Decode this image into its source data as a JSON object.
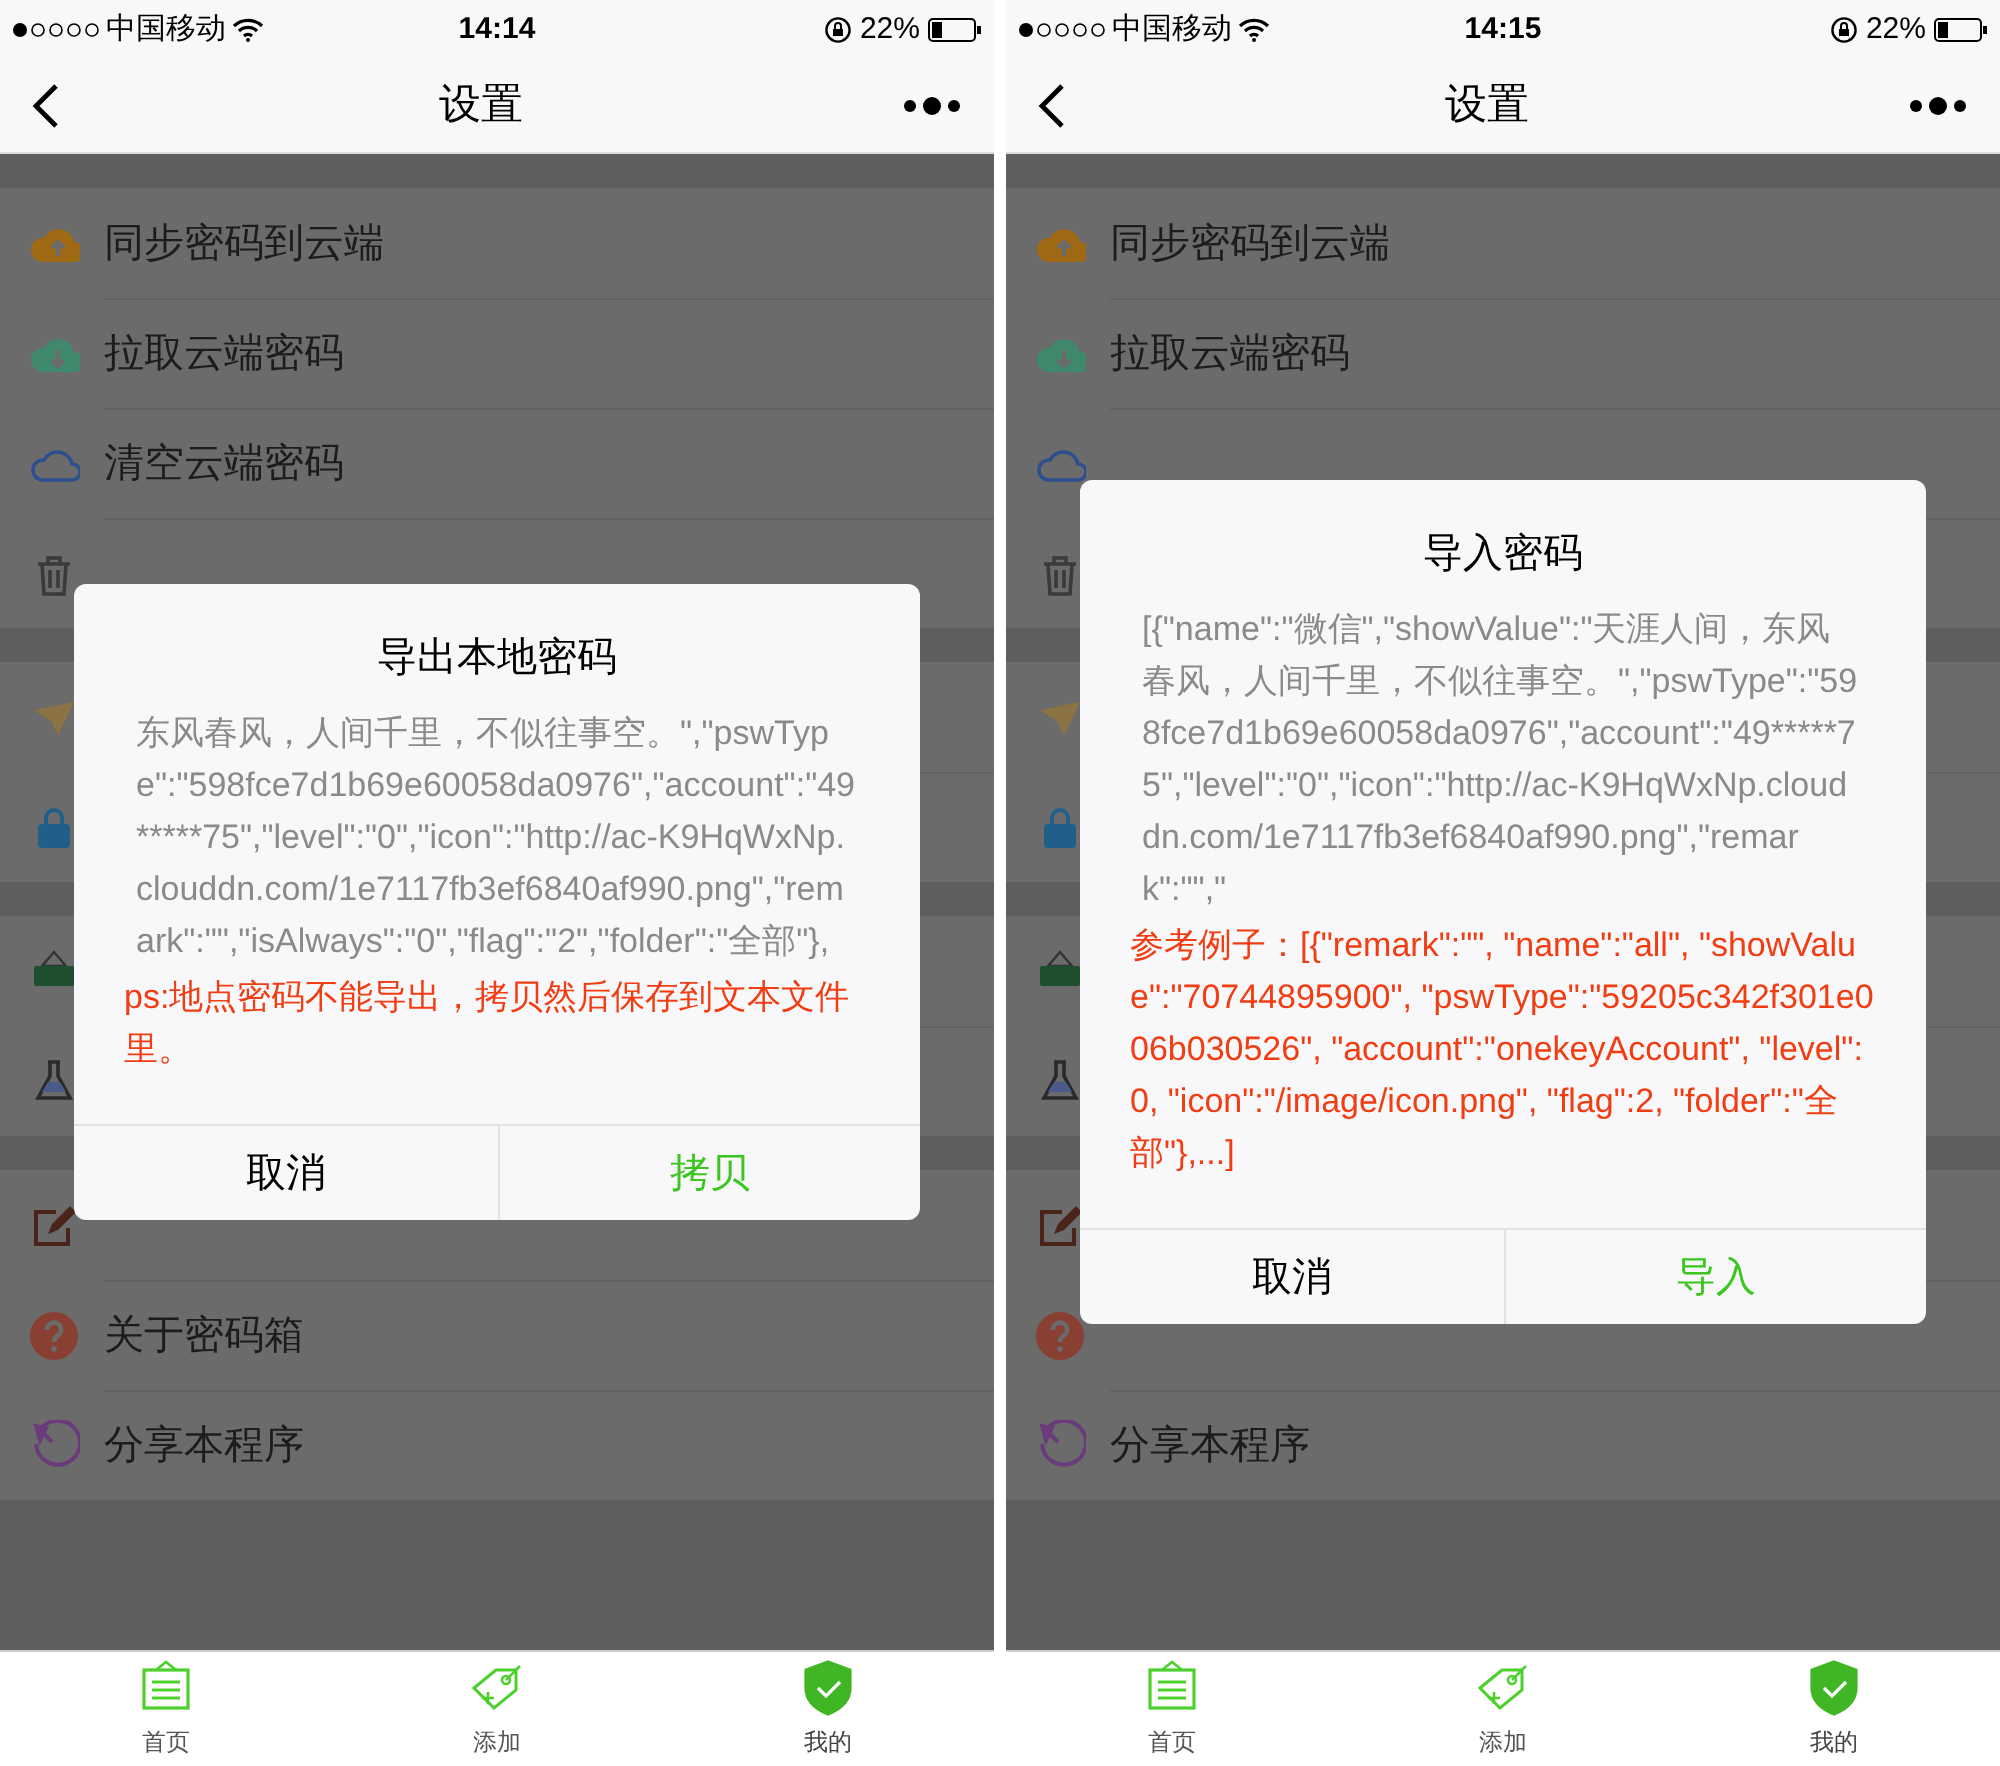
{
  "screens": [
    {
      "status_bar": {
        "carrier": "中国移动",
        "time": "14:14",
        "battery": "22%"
      },
      "nav": {
        "title": "设置"
      },
      "menu_groups": [
        {
          "items": [
            {
              "kind": "row",
              "label": "同步密码到云端"
            },
            {
              "kind": "row",
              "label": "拉取云端密码"
            },
            {
              "kind": "row",
              "label": "清空云端密码"
            },
            {
              "kind": "covered"
            }
          ]
        },
        {
          "items": [
            {
              "kind": "covered"
            },
            {
              "kind": "covered"
            }
          ]
        },
        {
          "items": [
            {
              "kind": "covered"
            },
            {
              "kind": "covered"
            }
          ]
        },
        {
          "items": [
            {
              "kind": "covered"
            },
            {
              "kind": "row",
              "label": "关于密码箱"
            },
            {
              "kind": "row",
              "label": "分享本程序"
            }
          ]
        }
      ],
      "dialog": {
        "title": "导出本地密码",
        "body": "东风春风，人间千里，不似往事空。\",\"pswType\":\"598fce7d1b69e60058da0976\",\"account\":\"49*****75\",\"level\":\"0\",\"icon\":\"http://ac-K9HqWxNp.clouddn.com/1e7117fb3ef6840af990.png\",\"remark\":\"\",\"isAlways\":\"0\",\"flag\":\"2\",\"folder\":\"全部\"},",
        "note": "ps:地点密码不能导出，拷贝然后保存到文本文件里。",
        "buttons": [
          {
            "kind": "cancel",
            "label": "取消"
          },
          {
            "kind": "confirm",
            "label": "拷贝"
          }
        ]
      },
      "tabs": [
        {
          "label": "首页",
          "selected": false
        },
        {
          "label": "添加",
          "selected": false
        },
        {
          "label": "我的",
          "selected": true
        }
      ]
    },
    {
      "status_bar": {
        "carrier": "中国移动",
        "time": "14:15",
        "battery": "22%"
      },
      "nav": {
        "title": "设置"
      },
      "menu_groups": [
        {
          "items": [
            {
              "kind": "row",
              "label": "同步密码到云端"
            },
            {
              "kind": "row",
              "label": "拉取云端密码"
            },
            {
              "kind": "covered"
            },
            {
              "kind": "covered"
            }
          ]
        },
        {
          "items": [
            {
              "kind": "covered"
            },
            {
              "kind": "covered"
            }
          ]
        },
        {
          "items": [
            {
              "kind": "covered"
            },
            {
              "kind": "covered"
            }
          ]
        },
        {
          "items": [
            {
              "kind": "covered"
            },
            {
              "kind": "covered"
            },
            {
              "kind": "row",
              "label": "分享本程序"
            }
          ]
        }
      ],
      "dialog": {
        "title": "导入密码",
        "body": "[{\"name\":\"微信\",\"showValue\":\"天涯人间，东风春风，人间千里，不似往事空。\",\"pswType\":\"598fce7d1b69e60058da0976\",\"account\":\"49*****75\",\"level\":\"0\",\"icon\":\"http://ac-K9HqWxNp.clouddn.com/1e7117fb3ef6840af990.png\",\"remark\":\"\",\"",
        "note": "参考例子：[{\"remark\":\"\", \"name\":\"all\", \"showValue\":\"70744895900\", \"pswType\":\"59205c342f301e006b030526\", \"account\":\"onekeyAccount\", \"level\":0, \"icon\":\"/image/icon.png\", \"flag\":2, \"folder\":\"全部\"},...]",
        "buttons": [
          {
            "kind": "cancel",
            "label": "取消"
          },
          {
            "kind": "confirm",
            "label": "导入"
          }
        ]
      },
      "tabs": [
        {
          "label": "首页",
          "selected": false
        },
        {
          "label": "添加",
          "selected": false
        },
        {
          "label": "我的",
          "selected": true
        }
      ]
    }
  ]
}
